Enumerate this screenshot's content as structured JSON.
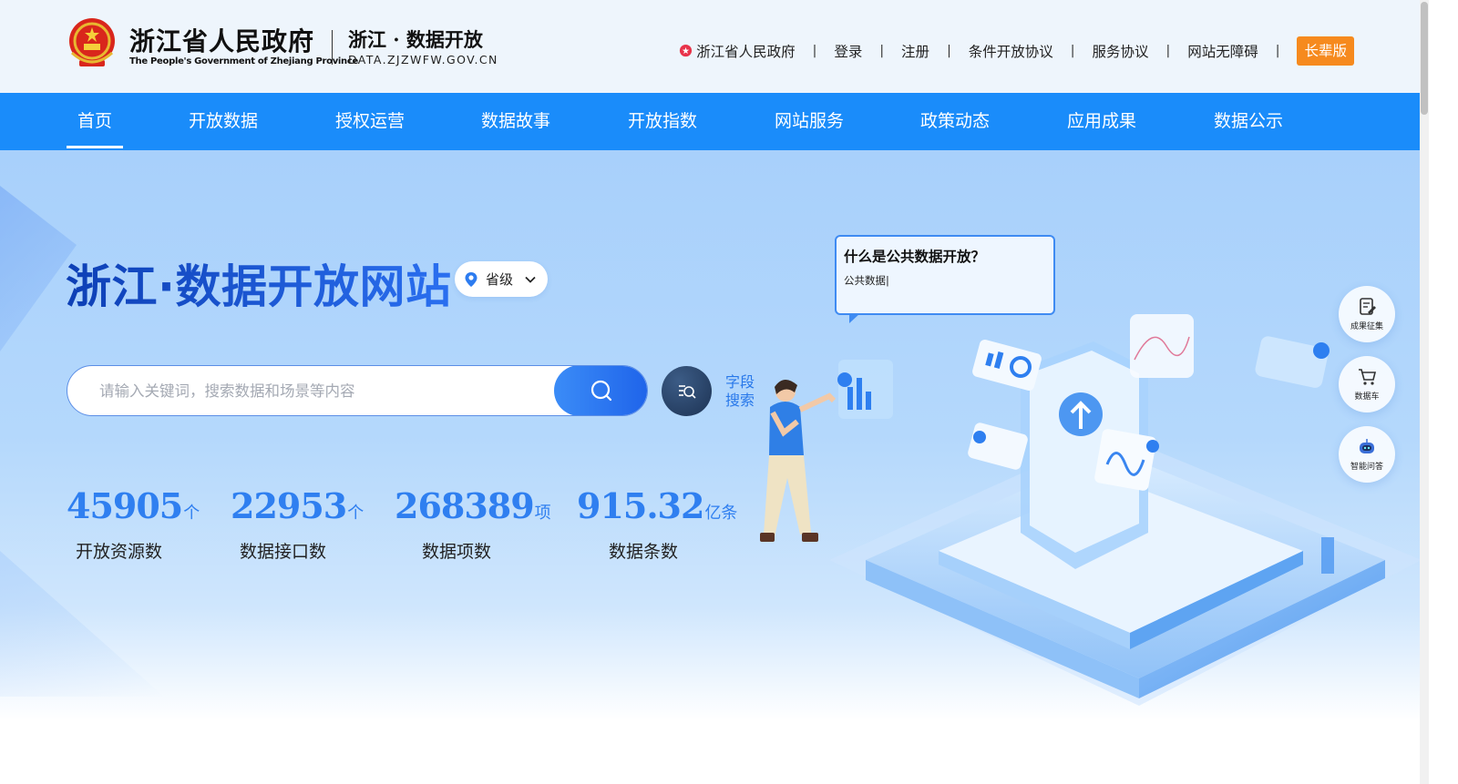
{
  "header": {
    "gov_name_cn": "浙江省人民政府",
    "gov_name_en": "The People's Government of Zhejiang Province",
    "brand_cn": "浙江 · 数据开放",
    "brand_en": "DATA.ZJZWFW.GOV.CN",
    "links": {
      "provincial_gov": "浙江省人民政府",
      "login": "登录",
      "register": "注册",
      "conditional_agreement": "条件开放协议",
      "service_agreement": "服务协议",
      "accessibility": "网站无障碍",
      "elder_version": "长辈版"
    },
    "separator": "|"
  },
  "nav": {
    "items": [
      {
        "label": "首页",
        "active": true
      },
      {
        "label": "开放数据"
      },
      {
        "label": "授权运营"
      },
      {
        "label": "数据故事"
      },
      {
        "label": "开放指数"
      },
      {
        "label": "网站服务"
      },
      {
        "label": "政策动态"
      },
      {
        "label": "应用成果"
      },
      {
        "label": "数据公示"
      }
    ]
  },
  "hero": {
    "title": "浙江·数据开放网站",
    "region": "省级",
    "search_placeholder": "请输入关键词，搜索数据和场景等内容",
    "field_search_label": "字段搜索",
    "bubble_title": "什么是公共数据开放？",
    "bubble_text": "公共数据|",
    "stats": [
      {
        "value": "45905",
        "unit": "个",
        "label": "开放资源数"
      },
      {
        "value": "22953",
        "unit": "个",
        "label": "数据接口数"
      },
      {
        "value": "268389",
        "unit": "项",
        "label": "数据项数"
      },
      {
        "value": "915.32",
        "unit": "亿条",
        "label": "数据条数"
      }
    ],
    "float_buttons": [
      {
        "label": "成果征集",
        "icon": "edit-doc-icon"
      },
      {
        "label": "数据车",
        "icon": "cart-icon"
      },
      {
        "label": "智能问答",
        "icon": "robot-icon"
      }
    ]
  },
  "colors": {
    "nav_blue": "#1a8cfa",
    "accent_orange": "#f68a1e",
    "stat_blue": "#2f7ff0",
    "title_blue": "#0d3fb5"
  }
}
